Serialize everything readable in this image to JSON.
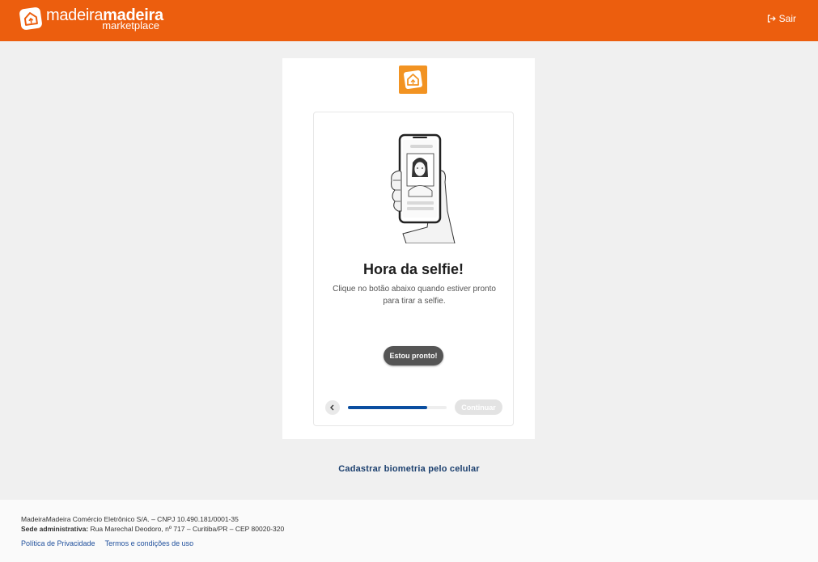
{
  "header": {
    "logo_light": "madeira",
    "logo_bold": "madeira",
    "logo_sub": "marketplace",
    "logout_label": "Sair",
    "logout_icon": "logout-icon"
  },
  "colors": {
    "brand_orange": "#ec5e0e",
    "logo_orange": "#f29322",
    "progress_blue": "#0a4ea0",
    "link_blue": "#1b3f6e"
  },
  "card": {
    "illustration": "selfie-phone-illustration",
    "title": "Hora da selfie!",
    "description_line1": "Clique no botão abaixo quando estiver pronto",
    "description_line2": "para tirar a selfie.",
    "ready_button": "Estou pronto!",
    "continue_button": "Continuar",
    "back_icon": "chevron-left-icon",
    "progress": 0.8
  },
  "mobile_link": "Cadastrar biometria pelo celular",
  "footer": {
    "company_line": "MadeiraMadeira Comércio Eletrônico S/A. – CNPJ 10.490.181/0001-35",
    "address_label": "Sede administrativa:",
    "address_value": "Rua Marechal Deodoro, nº 717 – Curitiba/PR – CEP 80020-320",
    "links": [
      "Política de Privacidade",
      "Termos e condições de uso"
    ]
  }
}
